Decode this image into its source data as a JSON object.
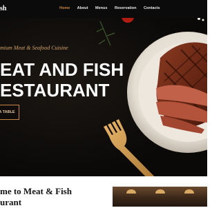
{
  "header": {
    "brand": "sh",
    "nav": [
      {
        "label": "Home",
        "active": true
      },
      {
        "label": "About"
      },
      {
        "label": "Menus"
      },
      {
        "label": "Reservation"
      },
      {
        "label": "Contacts"
      }
    ]
  },
  "hero": {
    "subtitle": "mium Meat & Seafood Cuisine",
    "title_line1": "EAT AND FISH",
    "title_line2": "ESTAURANT",
    "cta_label": "A TABLE"
  },
  "welcome": {
    "line1": "me to Meat & Fish",
    "line2": "urant"
  },
  "colors": {
    "accent": "#c9854a",
    "hero_bg": "#0a0908",
    "header_bg": "#0b0b0b"
  }
}
